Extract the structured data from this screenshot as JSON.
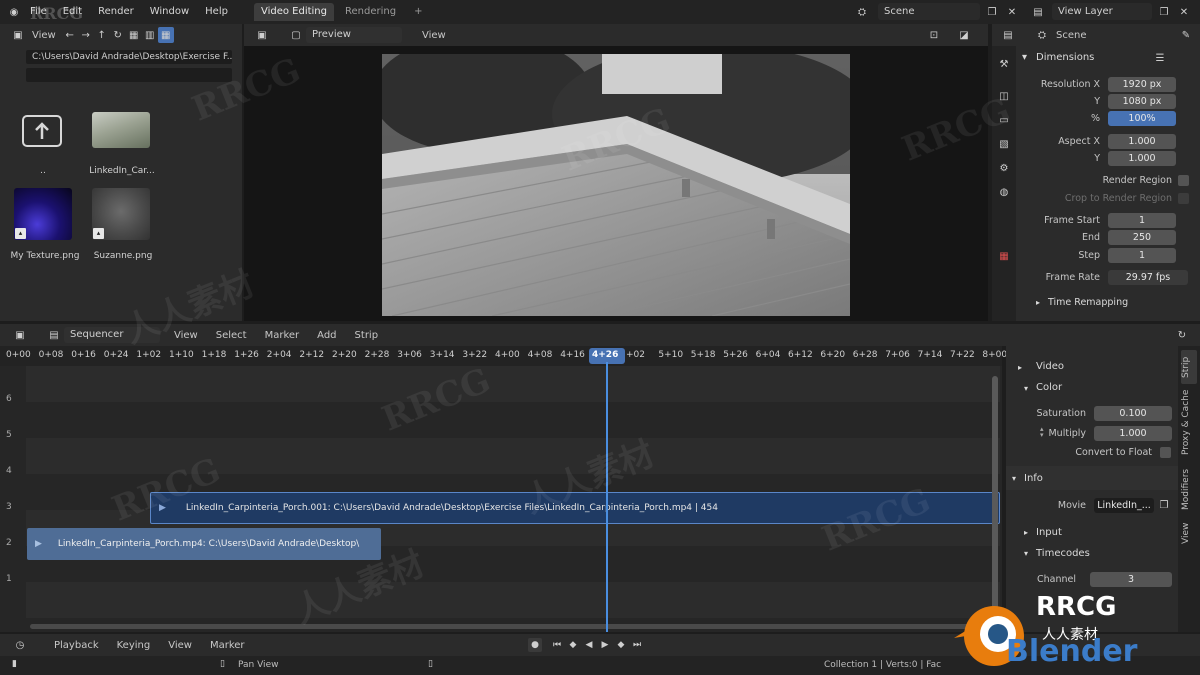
{
  "topbar": {
    "menu": [
      "File",
      "Edit",
      "Render",
      "Window",
      "Help"
    ],
    "workspaces": [
      "Video Editing",
      "Rendering"
    ],
    "add_workspace": "+",
    "scene": "Scene",
    "view_layer": "View Layer"
  },
  "filebrowser": {
    "view_label": "View",
    "path": "C:\\Users\\David Andrade\\Desktop\\Exercise F...",
    "items": [
      {
        "label": "..",
        "icon": "parent-folder-icon"
      },
      {
        "label": "LinkedIn_Car...",
        "icon": "video-thumbnail"
      },
      {
        "label": "My Texture.png",
        "icon": "image-thumbnail"
      },
      {
        "label": "Suzanne.png",
        "icon": "image-thumbnail"
      }
    ]
  },
  "preview": {
    "mode": "Preview",
    "view_label": "View"
  },
  "properties": {
    "scene": "Scene",
    "section": "Dimensions",
    "resolution_x_label": "Resolution X",
    "resolution_x": "1920 px",
    "resolution_y_label": "Y",
    "resolution_y": "1080 px",
    "percent_label": "%",
    "percent": "100%",
    "aspect_x_label": "Aspect X",
    "aspect_x": "1.000",
    "aspect_y_label": "Y",
    "aspect_y": "1.000",
    "render_region": "Render Region",
    "crop_region": "Crop to Render Region",
    "frame_start_label": "Frame Start",
    "frame_start": "1",
    "end_label": "End",
    "end": "250",
    "step_label": "Step",
    "step": "1",
    "frame_rate_label": "Frame Rate",
    "frame_rate": "29.97 fps",
    "time_remapping": "Time Remapping"
  },
  "sequencer": {
    "editor": "Sequencer",
    "menus": [
      "View",
      "Select",
      "Marker",
      "Add",
      "Strip"
    ],
    "ruler": [
      "0+00",
      "0+08",
      "0+16",
      "0+24",
      "1+02",
      "1+10",
      "1+18",
      "1+26",
      "2+04",
      "2+12",
      "2+20",
      "2+28",
      "3+06",
      "3+14",
      "3+22",
      "4+00",
      "4+08",
      "4+16",
      "4+26",
      "+02",
      "5+10",
      "5+18",
      "5+26",
      "6+04",
      "6+12",
      "6+20",
      "6+28",
      "7+06",
      "7+14",
      "7+22",
      "8+00"
    ],
    "current_frame": "4+26",
    "channels": [
      "6",
      "5",
      "4",
      "3",
      "2",
      "1"
    ],
    "strip_upper": "LinkedIn_Carpinteria_Porch.001: C:\\Users\\David Andrade\\Desktop\\Exercise Files\\LinkedIn_Carpinteria_Porch.mp4 | 454",
    "strip_lower": "LinkedIn_Carpinteria_Porch.mp4: C:\\Users\\David Andrade\\Desktop\\"
  },
  "strip_panel": {
    "video": "Video",
    "color": "Color",
    "saturation_label": "Saturation",
    "saturation": "0.100",
    "multiply_label": "Multiply",
    "multiply": "1.000",
    "convert_float": "Convert to Float",
    "info": "Info",
    "movie_label": "Movie",
    "movie": "LinkedIn_...",
    "input": "Input",
    "timecodes": "Timecodes",
    "channel_label": "Channel",
    "channel": "3",
    "tabs": [
      "Strip",
      "Proxy & Cache",
      "Modifiers",
      "View"
    ]
  },
  "timeline": {
    "playback": "Playback",
    "keying": "Keying",
    "view": "View",
    "marker": "Marker"
  },
  "status": {
    "pan_view": "Pan View",
    "info": "Collection 1 | Verts:0 | Fac"
  },
  "watermark": {
    "brand": "RRCG",
    "cjk": "人人素材",
    "logo_text": "RRCG",
    "logo_sub": "人人素材",
    "logo_blender": "Blender"
  }
}
